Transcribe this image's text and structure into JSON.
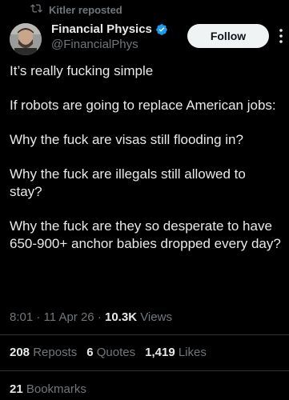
{
  "repost": {
    "icon": "repost-icon",
    "text": "Kitler reposted"
  },
  "author": {
    "display_name": "Financial Physics",
    "handle": "@FinancialPhys",
    "verified_icon": "verified-badge-icon",
    "verified_color": "#1d9bf0"
  },
  "follow_button": {
    "label": "Follow"
  },
  "more_button": {
    "icon": "more-vertical-icon"
  },
  "tweet": {
    "paragraphs": [
      "It’s really fucking simple",
      "If robots are going to replace American jobs:",
      "Why the fuck are visas still flooding in?",
      "Why the fuck are illegals still allowed to stay?",
      "Why the fuck are they so desperate to have 650-900+ anchor babies dropped every day?"
    ]
  },
  "meta": {
    "time": "8:01",
    "date": "11 Apr 26",
    "views_count": "10.3K",
    "views_label": "Views"
  },
  "stats": {
    "reposts": {
      "count": "208",
      "label": "Reposts"
    },
    "quotes": {
      "count": "6",
      "label": "Quotes"
    },
    "likes": {
      "count": "1,419",
      "label": "Likes"
    },
    "bookmarks": {
      "count": "21",
      "label": "Bookmarks"
    }
  },
  "colors": {
    "background": "#000000",
    "text_primary": "#e7e9ea",
    "text_secondary": "#71767b",
    "divider": "#2f3336",
    "follow_bg": "#eff3f4"
  }
}
